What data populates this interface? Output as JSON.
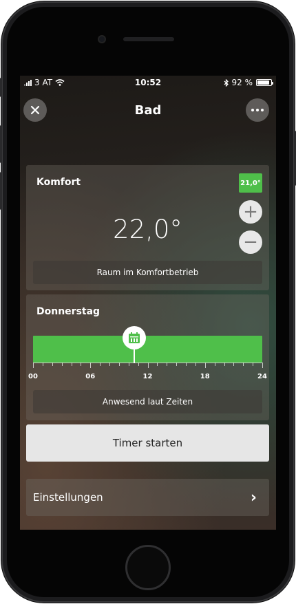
{
  "status_bar": {
    "carrier": "3 AT",
    "time": "10:52",
    "battery_percent": "92 %",
    "battery_level": 0.92
  },
  "header": {
    "title": "Bad",
    "close_icon": "close-icon",
    "more_icon": "more-dots-icon"
  },
  "comfort_card": {
    "title": "Komfort",
    "badge": "21,0°",
    "temperature": "22,0°",
    "status": "Raum im Komfortbetrieb",
    "plus_label": "+",
    "minus_label": "−"
  },
  "schedule_card": {
    "title": "Donnerstag",
    "tick_labels": [
      "00",
      "06",
      "12",
      "18",
      "24"
    ],
    "hour_range": [
      0,
      24
    ],
    "marker_hour": 10.6,
    "status": "Anwesend laut Zeiten"
  },
  "timer_button": "Timer starten",
  "settings": {
    "label": "Einstellungen",
    "chevron": "›"
  },
  "colors": {
    "accent_green": "#4fbf4a",
    "button_light": "#e6e6e6"
  }
}
